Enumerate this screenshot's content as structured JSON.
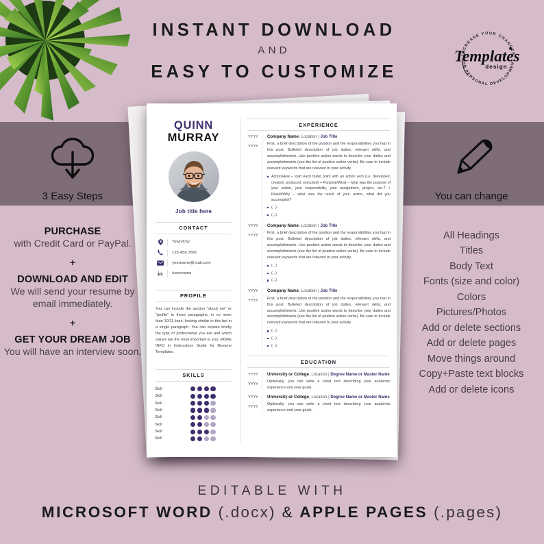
{
  "theme": {
    "bg_light": "#d6bcca",
    "bg_dark_band": "#7e6c77",
    "accent_purple": "#3f2f6e",
    "dot_off": "#b1a7c4",
    "paper": "#ffffff",
    "text_dark": "#1b1b1b"
  },
  "header": {
    "line1": "INSTANT DOWNLOAD",
    "line2": "AND",
    "line3": "EASY TO CUSTOMIZE"
  },
  "logo": {
    "brand": "Templates",
    "sub": "design",
    "arc_top": "INCREASE YOUR CHANCES",
    "arc_bottom": "FOR PERSONAL DEVELOPMENT"
  },
  "left_panel": {
    "icon": "cloud-download-icon",
    "icon_caption": "3 Easy Steps",
    "steps": [
      {
        "title": "PURCHASE",
        "sub": "with Credit Card or PayPal."
      },
      {
        "title": "DOWNLOAD AND EDIT",
        "sub": "We will send your resume by email immediately."
      },
      {
        "title": "GET YOUR DREAM JOB",
        "sub": "You will have an interview soon."
      }
    ],
    "plus": "+"
  },
  "right_panel": {
    "icon": "pencil-icon",
    "icon_caption": "You can change",
    "items": [
      "All Headings",
      "Titles",
      "Body Text",
      "Fonts (size and color)",
      "Colors",
      "Pictures/Photos",
      "Add or delete sections",
      "Add or delete pages",
      "Move things around",
      "Copy+Paste text blocks",
      "Add or delete icons"
    ]
  },
  "footer": {
    "line1": "EDITABLE WITH",
    "word_app": "MICROSOFT WORD",
    "word_ext": "(.docx)",
    "amp": "&",
    "pages_app": "APPLE PAGES",
    "pages_ext": "(.pages)"
  },
  "resume": {
    "first_name": "QUINN",
    "last_name": "MURRAY",
    "job_title": "Job title here",
    "avatar": "photo-of-man-with-glasses",
    "contact": {
      "heading": "CONTACT",
      "rows": [
        {
          "icon": "location-pin-icon",
          "value": "Town/City"
        },
        {
          "icon": "phone-icon",
          "value": "123.456.7891"
        },
        {
          "icon": "envelope-icon",
          "value": "yourname@mail.com"
        },
        {
          "icon": "linkedin-icon",
          "value": "/username"
        }
      ]
    },
    "profile": {
      "heading": "PROFILE",
      "text": "You can include the section \"about me\" or \"profile\" in these paragraphs, in no more than 10/11 lines, looking similar to this but in a single paragraph. You can explain briefly the type of professional you are and which values are the most important to you. MORE INFO in Instructions Guide for Resume Templates."
    },
    "skills": {
      "heading": "SKILLS",
      "label": "Skill",
      "max_dots": 4,
      "levels": [
        4,
        4,
        3,
        3,
        2,
        2,
        3,
        2
      ]
    },
    "experience": {
      "heading": "EXPERIENCE",
      "year_from": "YYYY",
      "year_to": "YYYY",
      "dash": "-",
      "company": "Company Name",
      "location": ", Location | ",
      "job_title": "Job Title",
      "paragraph": "First, a brief description of the position and the responsibilities you had in this post. Bulleted description of job duties, relevant skills, and accomplishments. Use positive action words to describe your duties and accomplishments (see the list of positive action verbs). Be sure to include relevant keywords that are relevant to your activity.",
      "entries": [
        {
          "bullets": [
            "Action/How – start each bullet point with an action verb (i.e. developed, created, produced, executed) + Purpose/What – what was the purpose of your action, your responsibility, your assignment, project, etc.? + Result/Why – what was the result of your action, what did you accomplish?",
            "(...)",
            "(...)"
          ]
        },
        {
          "bullets": [
            "(...)",
            "(...)",
            "(...)"
          ]
        },
        {
          "bullets": [
            "(...)",
            "(...)",
            "(...)"
          ]
        }
      ]
    },
    "education": {
      "heading": "EDUCATION",
      "year_from": "YYYY",
      "year_to": "YYYY",
      "dash": "-",
      "entries": [
        {
          "university": "University or College",
          "location": ", Location | ",
          "degree": "Degree Name or Master Name",
          "text": "Optionally, you can write a short text describing your academic experience and your goals."
        },
        {
          "university": "University or College",
          "location": ", Location | ",
          "degree": "Degree Name or Master Name",
          "text": "Optionally, you can write a short text describing your academic experience and your goals."
        }
      ]
    }
  }
}
